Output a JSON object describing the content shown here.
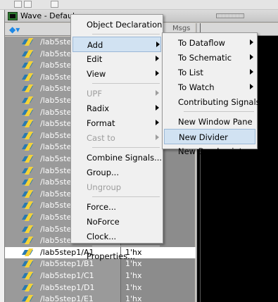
{
  "window": {
    "title": "Wave - Defaul"
  },
  "pane": {
    "msgs_label": "Msgs"
  },
  "signals": [
    {
      "name": "/lab5ste",
      "value": ""
    },
    {
      "name": "/lab5ste",
      "value": ""
    },
    {
      "name": "/lab5ste",
      "value": ""
    },
    {
      "name": "/lab5ste",
      "value": ""
    },
    {
      "name": "/lab5ste",
      "value": ""
    },
    {
      "name": "/lab5ste",
      "value": ""
    },
    {
      "name": "/lab5ste",
      "value": ""
    },
    {
      "name": "/lab5ste",
      "value": ""
    },
    {
      "name": "/lab5ste",
      "value": ""
    },
    {
      "name": "/lab5ste",
      "value": ""
    },
    {
      "name": "/lab5ste",
      "value": ""
    },
    {
      "name": "/lab5ste",
      "value": ""
    },
    {
      "name": "/lab5ste",
      "value": ""
    },
    {
      "name": "/lab5ste",
      "value": ""
    },
    {
      "name": "/lab5ste",
      "value": ""
    },
    {
      "name": "/lab5ste",
      "value": ""
    },
    {
      "name": "/lab5ste",
      "value": ""
    },
    {
      "name": "/lab5ste",
      "value": ""
    },
    {
      "name": "/lab5step1/A1",
      "value": "1'hx",
      "selected": true
    },
    {
      "name": "/lab5step1/B1",
      "value": "1'hx"
    },
    {
      "name": "/lab5step1/C1",
      "value": "1'hx"
    },
    {
      "name": "/lab5step1/D1",
      "value": "1'hx"
    },
    {
      "name": "/lab5step1/E1",
      "value": "1'hx"
    }
  ],
  "context_menu": {
    "items": [
      {
        "label": "Object Declaration",
        "type": "item"
      },
      {
        "type": "sep"
      },
      {
        "label": "Add",
        "type": "submenu",
        "highlighted": true
      },
      {
        "label": "Edit",
        "type": "submenu"
      },
      {
        "label": "View",
        "type": "submenu"
      },
      {
        "type": "sep"
      },
      {
        "label": "UPF",
        "type": "submenu",
        "disabled": true
      },
      {
        "label": "Radix",
        "type": "submenu"
      },
      {
        "label": "Format",
        "type": "submenu"
      },
      {
        "label": "Cast to",
        "type": "submenu",
        "disabled": true
      },
      {
        "type": "sep"
      },
      {
        "label": "Combine Signals...",
        "type": "item"
      },
      {
        "label": "Group...",
        "type": "item"
      },
      {
        "label": "Ungroup",
        "type": "item",
        "disabled": true
      },
      {
        "type": "sep"
      },
      {
        "label": "Force...",
        "type": "item"
      },
      {
        "label": "NoForce",
        "type": "item"
      },
      {
        "label": "Clock...",
        "type": "item"
      },
      {
        "type": "sep"
      },
      {
        "label": "Properties...",
        "type": "item"
      }
    ]
  },
  "add_submenu": {
    "items": [
      {
        "label": "To Dataflow",
        "type": "submenu"
      },
      {
        "label": "To Schematic",
        "type": "submenu"
      },
      {
        "label": "To List",
        "type": "submenu"
      },
      {
        "label": "To Watch",
        "type": "submenu"
      },
      {
        "label": "Contributing Signals",
        "type": "item"
      },
      {
        "type": "sep"
      },
      {
        "label": "New Window Pane",
        "type": "item"
      },
      {
        "label": "New Divider",
        "type": "item",
        "highlighted": true
      },
      {
        "label": "New Breakpoint",
        "type": "item"
      }
    ]
  },
  "colors": {
    "highlight": "#d1e2f2",
    "names_bg": "#9a9a9a",
    "wave_bg": "#000000"
  }
}
